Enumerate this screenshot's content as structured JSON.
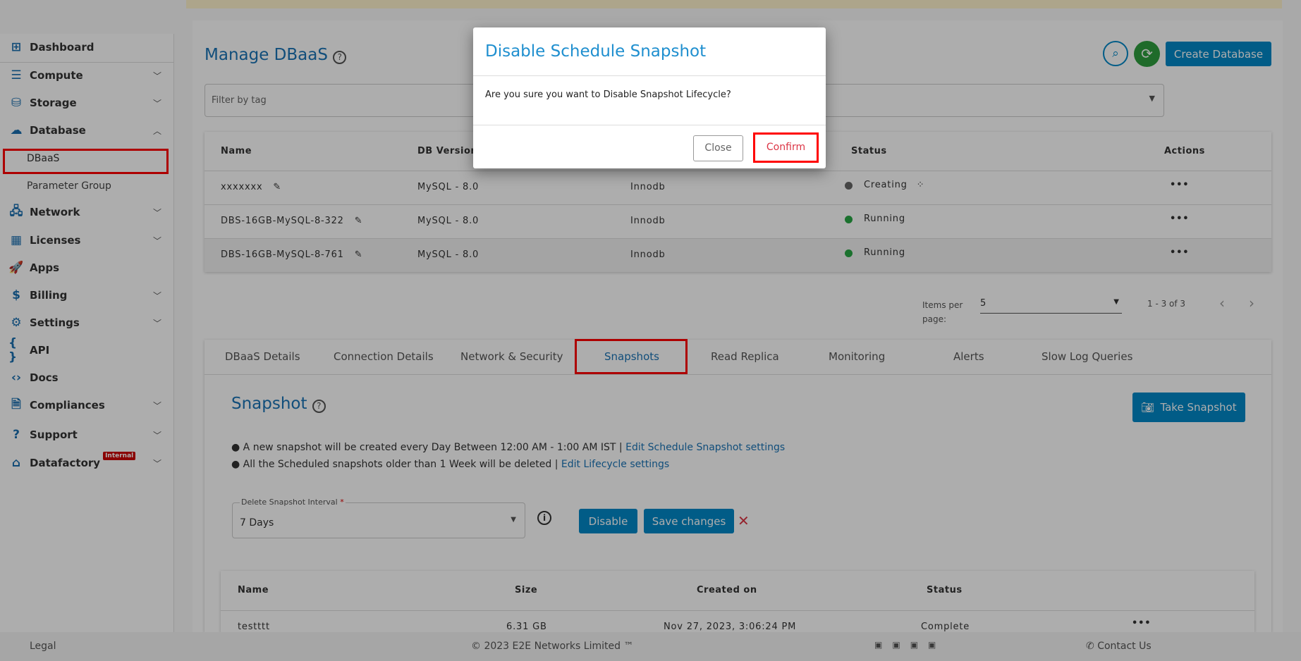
{
  "sidebar": {
    "items": [
      {
        "label": "Dashboard",
        "icon": "dashboard-icon",
        "glyph": "⊞",
        "chev": ""
      },
      {
        "label": "Compute",
        "icon": "server-icon",
        "glyph": "☰",
        "chev": "⌄"
      },
      {
        "label": "Storage",
        "icon": "storage-icon",
        "glyph": "⛁",
        "chev": "⌄"
      },
      {
        "label": "Database",
        "icon": "database-cloud-icon",
        "glyph": "☁",
        "chev": "⌃"
      },
      {
        "label": "Network",
        "icon": "network-icon",
        "glyph": "🖧",
        "chev": "⌄"
      },
      {
        "label": "Licenses",
        "icon": "licenses-icon",
        "glyph": "▦",
        "chev": "⌄"
      },
      {
        "label": "Apps",
        "icon": "rocket-icon",
        "glyph": "🚀",
        "chev": ""
      },
      {
        "label": "Billing",
        "icon": "billing-icon",
        "glyph": "$",
        "chev": "⌄"
      },
      {
        "label": "Settings",
        "icon": "gear-icon",
        "glyph": "⚙",
        "chev": "⌄"
      },
      {
        "label": "API",
        "icon": "braces-icon",
        "glyph": "{ }",
        "chev": ""
      },
      {
        "label": "Docs",
        "icon": "code-icon",
        "glyph": "‹›",
        "chev": ""
      },
      {
        "label": "Compliances",
        "icon": "document-icon",
        "glyph": "🗎",
        "chev": "⌄"
      },
      {
        "label": "Support",
        "icon": "support-icon",
        "glyph": "?",
        "chev": "⌄"
      },
      {
        "label": "Datafactory",
        "icon": "factory-icon",
        "glyph": "⌂",
        "chev": "⌄"
      }
    ],
    "subitems": [
      "DBaaS",
      "Parameter Group"
    ],
    "badge": "Internal"
  },
  "header": {
    "title": "Manage DBaaS",
    "create_label": "Create Database",
    "filter_placeholder": "Filter by tag"
  },
  "db_table": {
    "columns": [
      "Name",
      "DB Version",
      "",
      "Status",
      "Actions"
    ],
    "rows": [
      {
        "name": "xxxxxxx",
        "version": "MySQL - 8.0",
        "engine": "Innodb",
        "status": "Creating",
        "status_color": "#666666"
      },
      {
        "name": "DBS-16GB-MySQL-8-322",
        "version": "MySQL - 8.0",
        "engine": "Innodb",
        "status": "Running",
        "status_color": "#28a745"
      },
      {
        "name": "DBS-16GB-MySQL-8-761",
        "version": "MySQL - 8.0",
        "engine": "Innodb",
        "status": "Running",
        "status_color": "#28a745"
      }
    ]
  },
  "pagination": {
    "items_per_page_label": "Items per",
    "items_per_page_label2": "page:",
    "value": "5",
    "range": "1 - 3 of 3"
  },
  "tabs": [
    "DBaaS Details",
    "Connection Details",
    "Network & Security",
    "Snapshots",
    "Read Replica",
    "Monitoring",
    "Alerts",
    "Slow Log Queries"
  ],
  "snapshot": {
    "title": "Snapshot",
    "take_label": "Take Snapshot",
    "line1": "A new snapshot will be created every Day Between 12:00 AM - 1:00 AM IST |",
    "link1": "Edit Schedule Snapshot settings",
    "line2": "All the Scheduled snapshots older than 1 Week will be deleted |",
    "link2": "Edit Lifecycle settings",
    "interval_label": "Delete Snapshot Interval",
    "required": "*",
    "interval_value": "7 Days",
    "disable_label": "Disable",
    "save_label": "Save changes",
    "cancel_glyph": "✕",
    "columns": [
      "Name",
      "Size",
      "Created on",
      "Status"
    ],
    "rows": [
      {
        "name": "testttt",
        "size": "6.31 GB",
        "created": "Nov 27, 2023, 3:06:24 PM",
        "status": "Complete"
      }
    ]
  },
  "modal": {
    "title": "Disable Schedule Snapshot",
    "body": "Are you sure you want to Disable Snapshot Lifecycle?",
    "close_label": "Close",
    "confirm_label": "Confirm"
  },
  "footer": {
    "legal": "Legal",
    "copyright": "© 2023 E2E Networks Limited ™",
    "contact": "Contact Us"
  },
  "colors": {
    "accent": "#0288c7",
    "danger": "#dc3545"
  }
}
